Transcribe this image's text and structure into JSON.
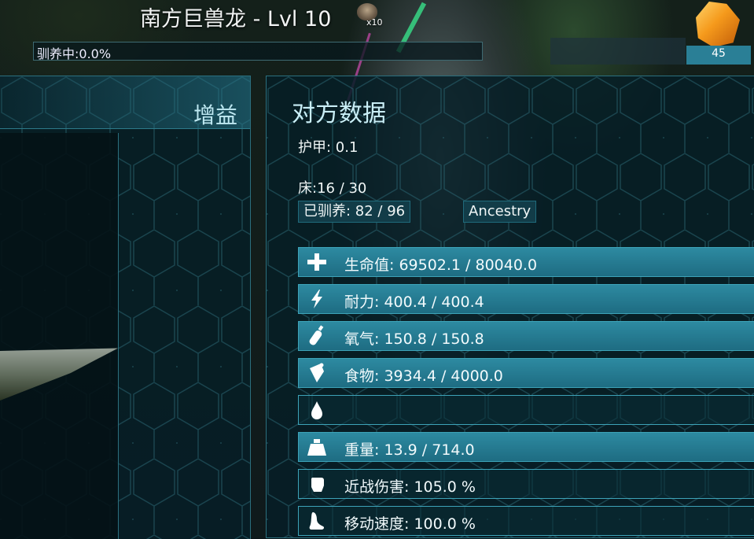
{
  "header": {
    "creature_title": "南方巨兽龙 - Lvl 10",
    "item_count": "x10",
    "taming_status": "驯养中:0.0%",
    "resource_count": "45"
  },
  "left_panel": {
    "title": "增益"
  },
  "right_panel": {
    "title": "对方数据",
    "armor": "护甲: 0.1",
    "bed": "床:16 / 30",
    "tamed": "已驯养: 82 / 96",
    "ancestry_button": "Ancestry"
  },
  "stats": [
    {
      "icon": "health-cross-icon",
      "text": "生命值: 69502.1 / 80040.0"
    },
    {
      "icon": "stamina-bolt-icon",
      "text": "耐力: 400.4 / 400.4"
    },
    {
      "icon": "oxygen-tank-icon",
      "text": "氧气: 150.8 / 150.8"
    },
    {
      "icon": "food-drumstick-icon",
      "text": "食物: 3934.4 / 4000.0"
    },
    {
      "icon": "water-drop-icon",
      "text": ""
    },
    {
      "icon": "weight-icon",
      "text": "重量: 13.9 / 714.0"
    },
    {
      "icon": "melee-fist-icon",
      "text": "近战伤害: 105.0 %"
    },
    {
      "icon": "movement-foot-icon",
      "text": "移动速度: 100.0 %"
    }
  ],
  "colors": {
    "accent": "#2d8aa1",
    "panel_bg": "#061e26",
    "gem": "#f59a1c"
  }
}
